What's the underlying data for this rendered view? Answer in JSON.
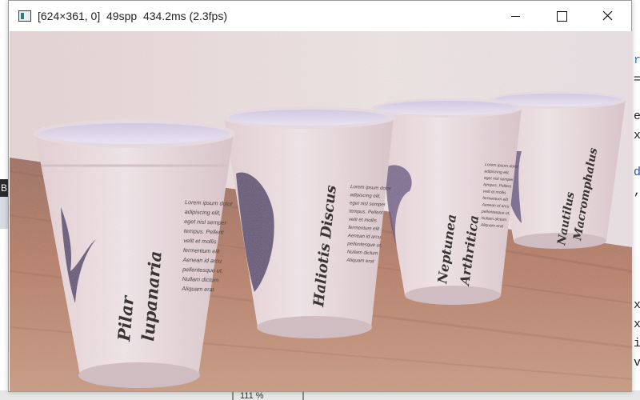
{
  "window": {
    "title": "[624×361, 0]  49spp  434.2ms (2.3fps)",
    "controls": {
      "minimize": "minimize",
      "maximize": "maximize",
      "close": "close"
    }
  },
  "scene": {
    "cups": [
      {
        "name_line1": "Pilar",
        "name_line2": "lupanaria"
      },
      {
        "name_line1": "Haliotis Discus",
        "name_line2": ""
      },
      {
        "name_line1": "Neptunea",
        "name_line2": "Arthritica"
      },
      {
        "name_line1": "Nautilus",
        "name_line2": "Macromphalus"
      }
    ],
    "lorem_lines": [
      "Lorem ipsum dolor",
      "adipiscing elit,",
      "eget nisl semper",
      "tempus. Pellent",
      "velit et mollis",
      "fermentum elit",
      "Aenean id arcu",
      "pellentesque ut,",
      "Nullam dictum",
      "Aliquam erat"
    ]
  },
  "background_app": {
    "left_fragment": "B",
    "right_fragments": [
      "r",
      "=",
      "e",
      "x",
      "d",
      ",",
      "x",
      "x",
      "i",
      "v"
    ],
    "zoom_label": "111 %"
  },
  "colors": {
    "wall": "#ece0e0",
    "table": "#b9785c",
    "cup": "#efe0e3",
    "cup_text": "#3a3434",
    "illustration": "#4b3b6e"
  }
}
